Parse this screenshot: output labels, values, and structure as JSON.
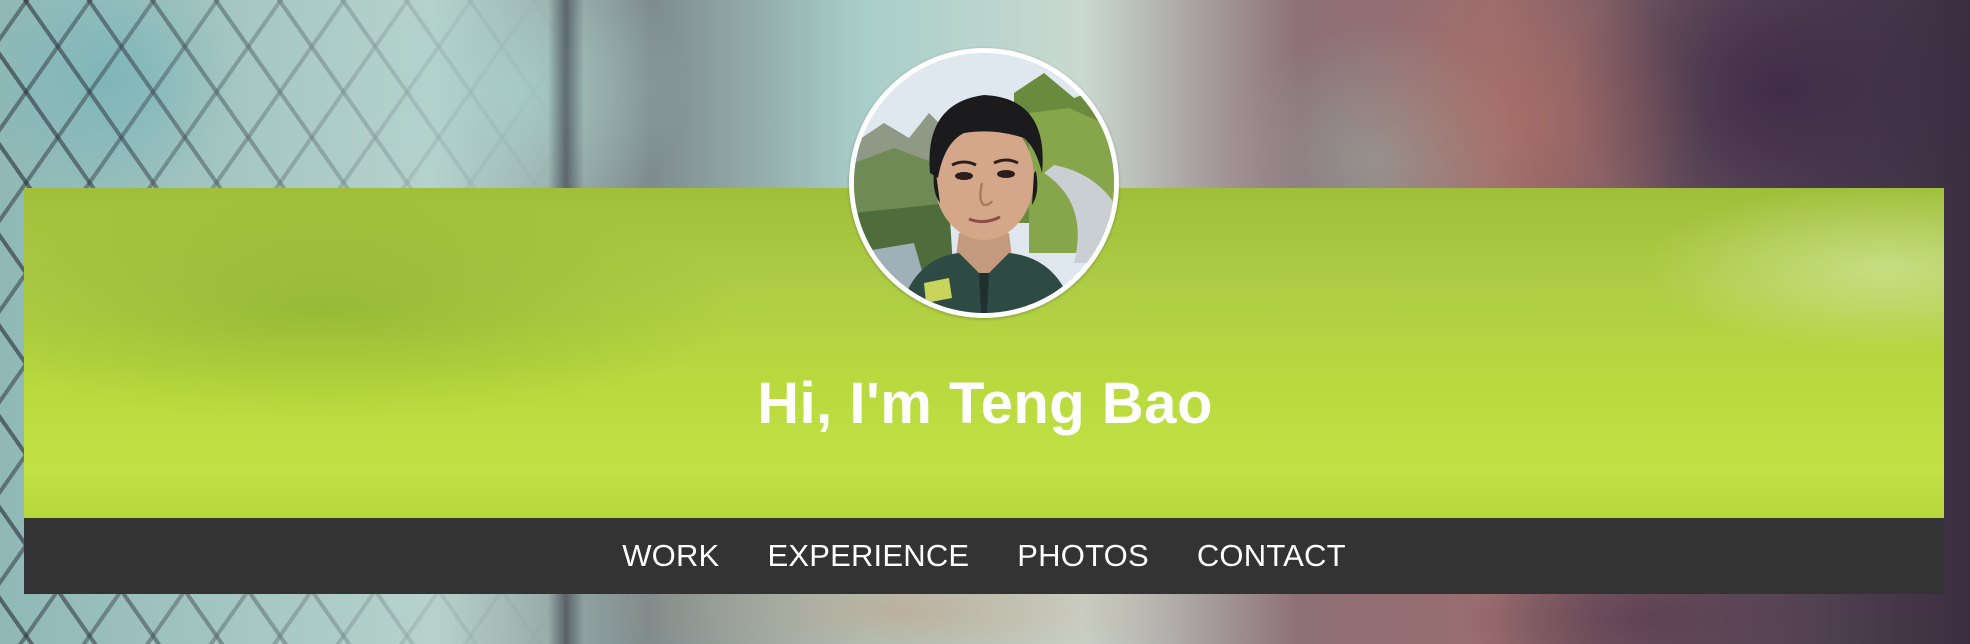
{
  "hero": {
    "title": "Hi, I'm Teng Bao",
    "banner_color": "#b9da3e",
    "avatar_icon": "profile-photo"
  },
  "nav": {
    "background": "#333333",
    "items": [
      {
        "label": "WORK"
      },
      {
        "label": "EXPERIENCE"
      },
      {
        "label": "PHOTOS"
      },
      {
        "label": "CONTACT"
      }
    ]
  }
}
